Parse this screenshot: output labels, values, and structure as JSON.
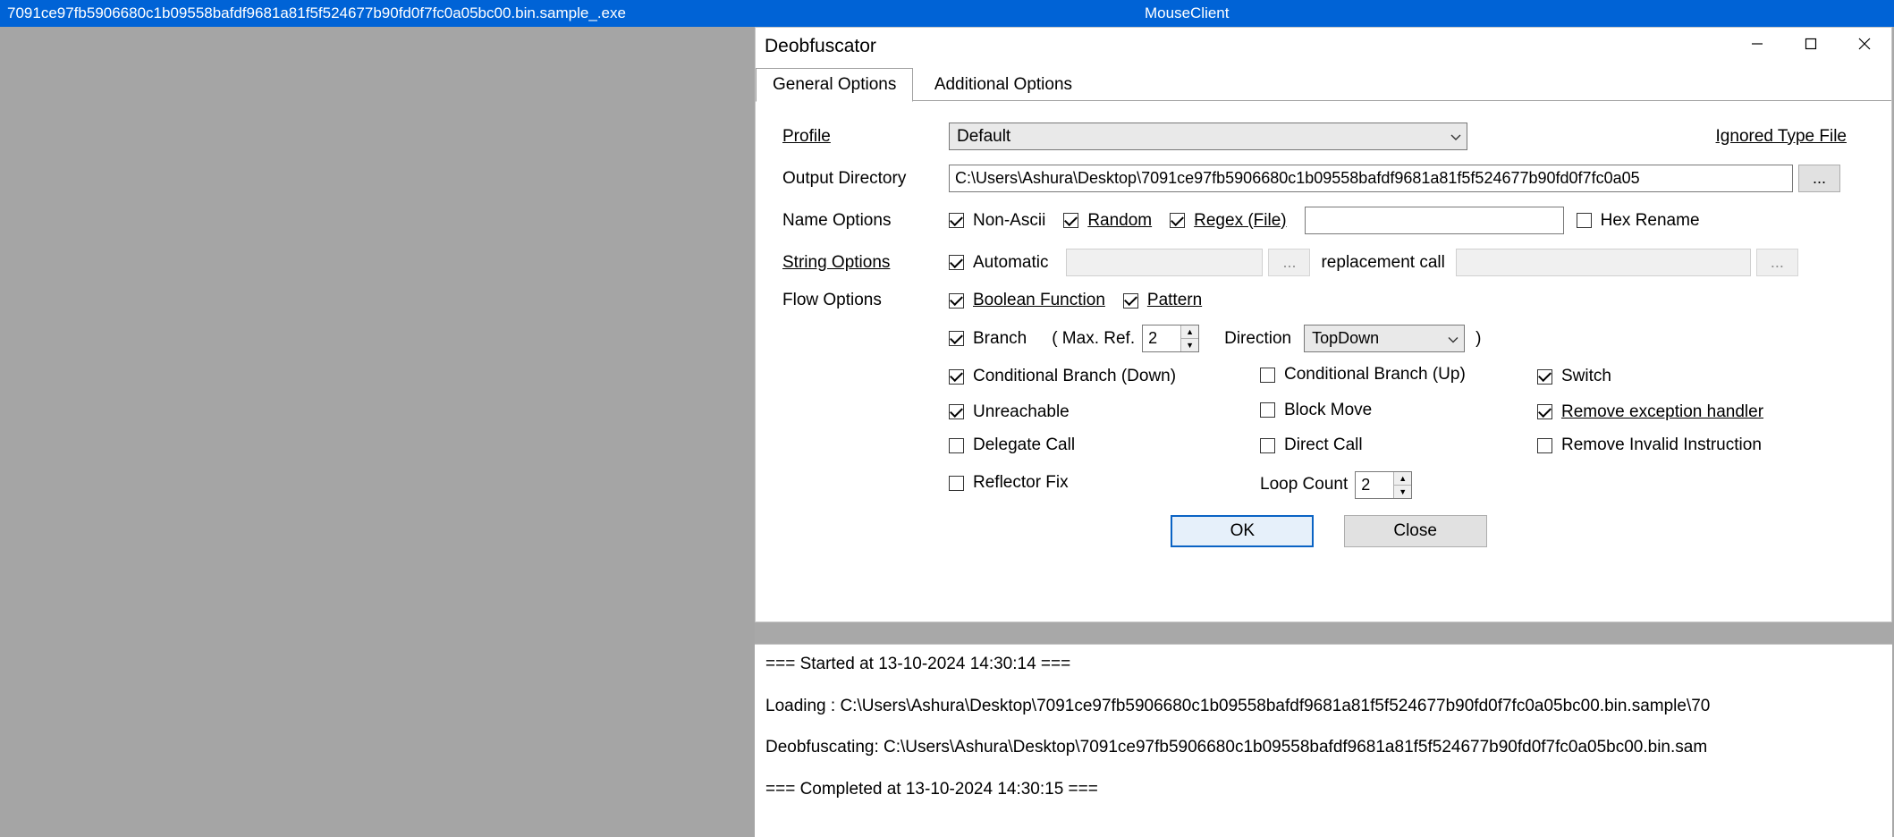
{
  "titlebar_left": "7091ce97fb5906680c1b09558bafdf9681a81f5f524677b90fd0f7fc0a05bc00.bin.sample_.exe",
  "titlebar_right": "MouseClient",
  "dialog": {
    "title": "Deobfuscator",
    "tabs": {
      "general": "General Options",
      "additional": "Additional Options"
    },
    "profile_label": "Profile",
    "profile_value": "Default",
    "ignored_type_file": "Ignored Type File",
    "output_dir_label": "Output Directory",
    "output_dir_value": "C:\\Users\\Ashura\\Desktop\\7091ce97fb5906680c1b09558bafdf9681a81f5f524677b90fd0f7fc0a05",
    "name_options_label": "Name Options",
    "non_ascii": "Non-Ascii",
    "random": "Random",
    "regex_file": "Regex (File)",
    "regex_value": "",
    "hex_rename": "Hex Rename",
    "string_options_label": "String Options",
    "automatic": "Automatic",
    "replacement_call": "replacement call",
    "flow_options_label": "Flow Options",
    "boolean_function": "Boolean Function",
    "pattern": "Pattern",
    "branch": "Branch",
    "max_ref_label": "(   Max. Ref.",
    "max_ref_value": "2",
    "direction_label": "Direction",
    "direction_value": "TopDown",
    "close_paren": ")",
    "cond_branch_down": "Conditional Branch (Down)",
    "cond_branch_up": "Conditional Branch (Up)",
    "switch": "Switch",
    "unreachable": "Unreachable",
    "block_move": "Block Move",
    "remove_exception": "Remove exception handler",
    "delegate_call": "Delegate Call",
    "direct_call": "Direct Call",
    "remove_invalid": "Remove Invalid Instruction",
    "reflector_fix": "Reflector Fix",
    "loop_count_label": "Loop Count",
    "loop_count_value": "2",
    "ok": "OK",
    "close": "Close",
    "ellipsis": "..."
  },
  "log": {
    "l1": "=== Started at 13-10-2024 14:30:14 ===",
    "l2": "Loading : C:\\Users\\Ashura\\Desktop\\7091ce97fb5906680c1b09558bafdf9681a81f5f524677b90fd0f7fc0a05bc00.bin.sample\\70",
    "l3": "Deobfuscating: C:\\Users\\Ashura\\Desktop\\7091ce97fb5906680c1b09558bafdf9681a81f5f524677b90fd0f7fc0a05bc00.bin.sam",
    "l4": "=== Completed at 13-10-2024 14:30:15 ==="
  }
}
